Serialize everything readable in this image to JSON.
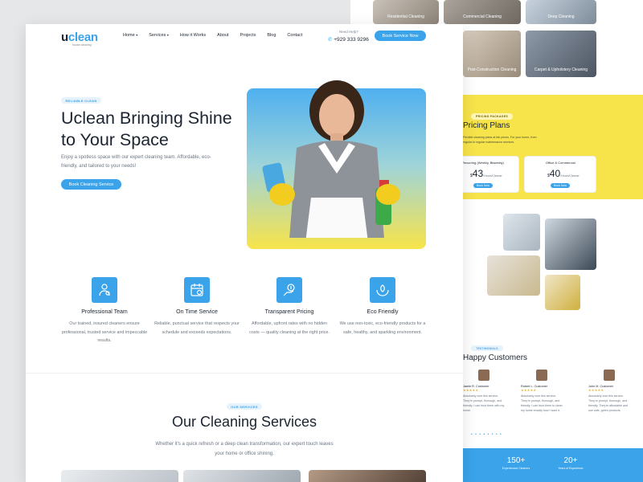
{
  "brand": {
    "name_prefix": "u",
    "name_rest": "clean",
    "tagline": "house cleaning"
  },
  "nav": {
    "items": [
      {
        "label": "Home",
        "caret": true
      },
      {
        "label": "Services",
        "caret": true
      },
      {
        "label": "How it Works",
        "caret": false
      },
      {
        "label": "About",
        "caret": false
      },
      {
        "label": "Projects",
        "caret": false
      },
      {
        "label": "Blog",
        "caret": false
      },
      {
        "label": "Contact",
        "caret": false
      }
    ],
    "help_label": "Need Help?",
    "phone": "+929 333 9296",
    "cta": "Book Service Now"
  },
  "hero": {
    "badge": "RELIABLE CLEAN",
    "title": "Uclean Bringing Shine to Your Space",
    "description": "Enjoy a spotless space with our expert cleaning team. Affordable, eco-friendly, and tailored to your needs!",
    "cta": "Book Cleaning Service"
  },
  "features": [
    {
      "icon": "team-icon",
      "title": "Professional Team",
      "description": "Our trained, insured cleaners ensure professional, trusted service and impeccable results."
    },
    {
      "icon": "calendar-icon",
      "title": "On Time Service",
      "description": "Reliable, punctual service that respects your schedule and exceeds expectations."
    },
    {
      "icon": "pricing-icon",
      "title": "Transparent Pricing",
      "description": "Affordable, upfront rates with no hidden costs — quality cleaning at the right price."
    },
    {
      "icon": "leaf-hands-icon",
      "title": "Eco Friendly",
      "description": "We use non-toxic, eco-friendly products for a safe, healthy, and sparkling environment."
    }
  ],
  "services": {
    "badge": "OUR SERVICES",
    "title": "Our Cleaning Services",
    "description": "Whether it's a quick refresh or a deep clean transformation, our expert touch leaves your home or office shining."
  },
  "background_page": {
    "gallery_captions": [
      "Residential Cleaning",
      "Commercial Cleaning",
      "Deep Cleaning",
      "Post-Construction Cleaning",
      "Carpet & Upholstery Cleaning"
    ],
    "pricing": {
      "badge": "PRICING PACKAGES",
      "title": "Pricing Plans",
      "description": "Flexible cleaning plans at fair prices. For your home, from regular to regular maintenance services.",
      "plans": [
        {
          "name": "Recurring (Weekly, Biweekly)",
          "currency": "$",
          "price": "43",
          "unit": "/Hours/Cleaner",
          "cta": "Book Now"
        },
        {
          "name": "Office & Commercial",
          "currency": "$",
          "price": "40",
          "unit": "/Hours/Cleaner",
          "cta": "Book Now"
        }
      ]
    },
    "testimonials": {
      "badge": "TESTIMONIALS",
      "title": "Happy Customers",
      "reviews": [
        {
          "name": "Jamie R. Customer",
          "stars": "★★★★★",
          "text": "Absolutely love this service. They're prompt, thorough, and friendly. I can trust them with my home."
        },
        {
          "name": "Robert L. Customer",
          "stars": "★★★★★",
          "text": "Absolutely love this service. They're prompt, thorough, and friendly. I can trust them to clean my home exactly how I want it."
        },
        {
          "name": "John M. Customer",
          "stars": "★★★★★",
          "text": "Absolutely love this service. They're prompt, thorough, and friendly. They're affordable and use safe, green products."
        }
      ]
    },
    "stats": [
      {
        "value": "150+",
        "label": "Experienced Cleaners"
      },
      {
        "value": "20+",
        "label": "Years of Experience"
      }
    ]
  },
  "colors": {
    "accent": "#3aa3ea",
    "yellow": "#f7e44a",
    "dark": "#1b2430"
  }
}
